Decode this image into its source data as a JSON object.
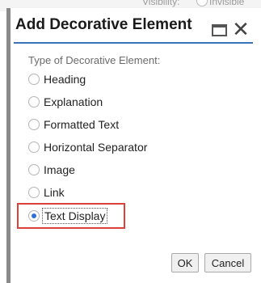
{
  "background": {
    "field_label": "Visibility:",
    "radio_label": "Invisible"
  },
  "dialog": {
    "title": "Add Decorative Element",
    "maximize_icon": "maximize-icon",
    "close_icon": "close-icon",
    "close_glyph": "✕",
    "section_label": "Type of Decorative Element:",
    "options": [
      {
        "label": "Heading",
        "checked": false
      },
      {
        "label": "Explanation",
        "checked": false
      },
      {
        "label": "Formatted Text",
        "checked": false
      },
      {
        "label": "Horizontal Separator",
        "checked": false
      },
      {
        "label": "Image",
        "checked": false
      },
      {
        "label": "Link",
        "checked": false
      },
      {
        "label": "Text Display",
        "checked": true
      }
    ],
    "ok_label": "OK",
    "cancel_label": "Cancel"
  },
  "colors": {
    "accent": "#3b73b9",
    "highlight": "#d9423a",
    "radio_checked": "#2f6fd6"
  }
}
